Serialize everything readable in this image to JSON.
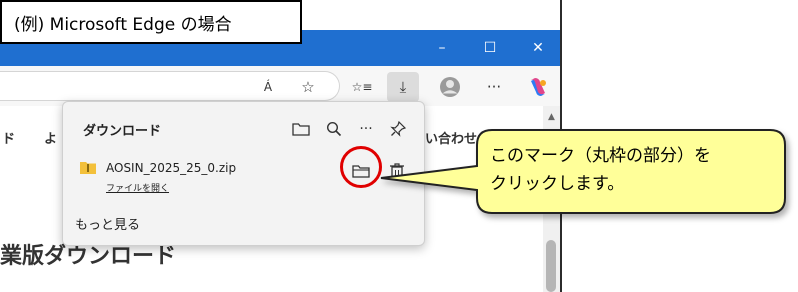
{
  "label_box": {
    "text": "(例) Microsoft  Edge の場合"
  },
  "window_controls": {
    "minimize": "–",
    "maximize": "☐",
    "close": "✕"
  },
  "toolbar": {
    "read_aloud": "Á",
    "favorite": "☆",
    "favorites_list": "☆≡",
    "downloads": "⤓",
    "more": "···"
  },
  "page": {
    "nav_left": "ド",
    "nav_left2": "よ",
    "nav_right": "い合わせ",
    "heading": "業版ダウンロード",
    "scroll_arrow": "▲"
  },
  "downloads_panel": {
    "title": "ダウンロード",
    "file_name": "AOSIN_2025_25_0.zip",
    "open_file": "ファイルを開く",
    "see_more": "もっと見る",
    "more_options": "···"
  },
  "callout": {
    "line1": "このマーク（丸枠の部分）を",
    "line2": "クリックします。"
  },
  "colors": {
    "titlebar": "#1f6fd0",
    "callout_fill": "#ffff99",
    "highlight": "#e00000"
  }
}
